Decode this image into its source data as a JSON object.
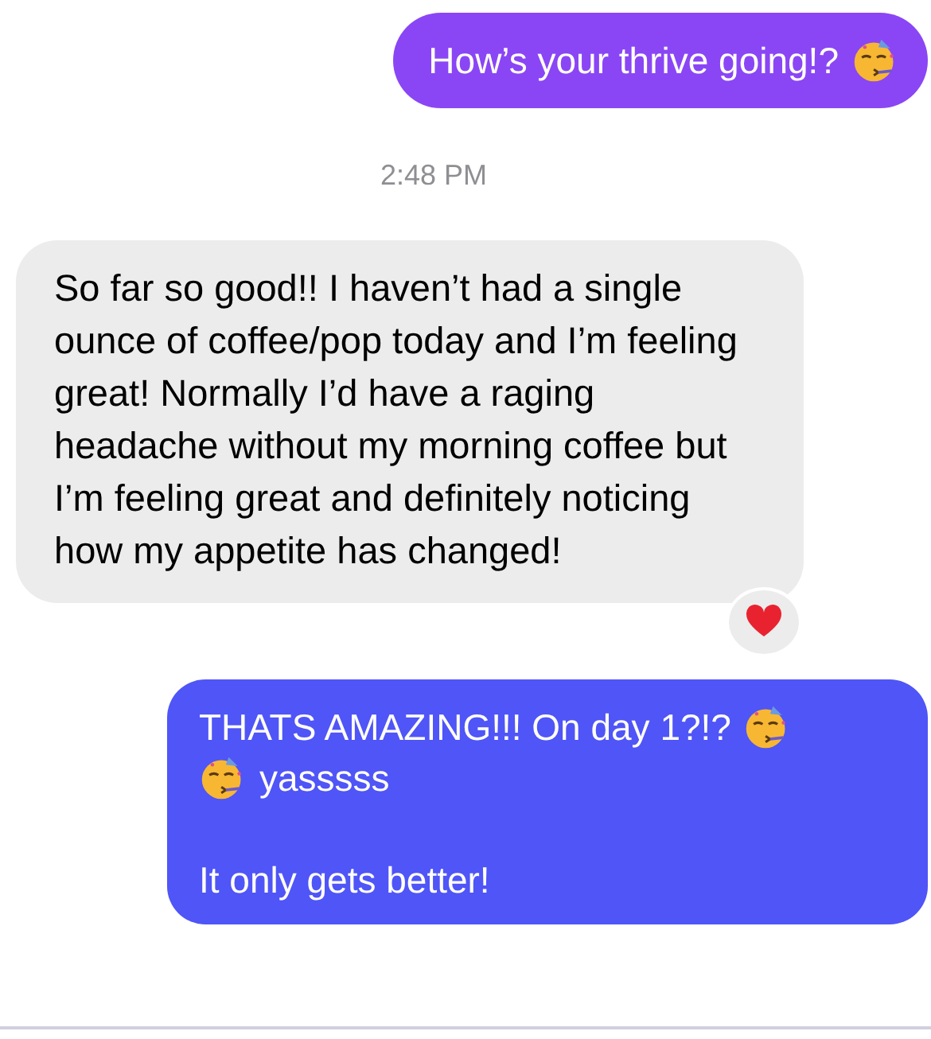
{
  "messages": [
    {
      "kind": "outgoing",
      "color": "#8a46f4",
      "paragraphs": [
        {
          "lines": [
            [
              {
                "kind": "text",
                "text": "How’s your thrive going!?"
              },
              {
                "kind": "emoji"
              }
            ]
          ]
        }
      ]
    },
    {
      "kind": "timestamp",
      "text": "2:48 PM"
    },
    {
      "kind": "incoming",
      "reacted": true,
      "text": "So far so good!! I haven’t had a single ounce of coffee/pop today and I’m feeling great! Normally I’d have a raging headache without my morning coffee but I’m feeling great and definitely noticing how my appetite has changed!"
    },
    {
      "kind": "outgoing",
      "color": "#4f55f6",
      "paragraphs": [
        {
          "lines": [
            [
              {
                "kind": "text",
                "text": "THATS AMAZING!!! On day 1?!?"
              },
              {
                "kind": "emoji"
              }
            ],
            [
              {
                "kind": "emoji"
              },
              {
                "kind": "text",
                "text": "yasssss"
              }
            ]
          ]
        },
        {
          "lines": [
            [
              {
                "kind": "text",
                "text": "It only gets better!"
              }
            ]
          ]
        }
      ]
    }
  ]
}
